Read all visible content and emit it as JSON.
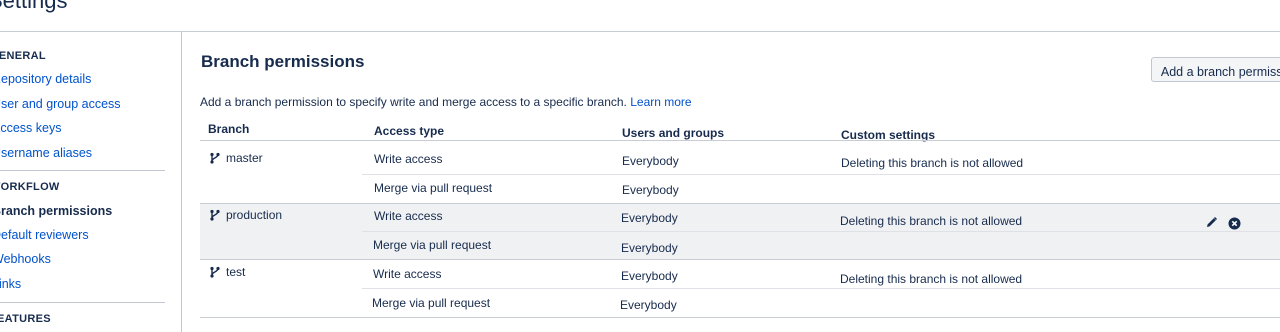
{
  "page": {
    "title": "Settings"
  },
  "sidebar": {
    "sections": [
      {
        "heading": "GENERAL",
        "items": [
          {
            "label": "Repository details"
          },
          {
            "label": "User and group access"
          },
          {
            "label": "Access keys"
          },
          {
            "label": "Username aliases"
          }
        ]
      },
      {
        "heading": "WORKFLOW",
        "items": [
          {
            "label": "Branch permissions",
            "active": true
          },
          {
            "label": "Default reviewers"
          },
          {
            "label": "Webhooks"
          },
          {
            "label": "Links"
          }
        ]
      },
      {
        "heading": "FEATURES",
        "items": []
      }
    ]
  },
  "main": {
    "title": "Branch permissions",
    "add_button": "Add a branch permission",
    "description": "Add a branch permission to specify write and merge access to a specific branch.",
    "learn_more": "Learn more",
    "columns": [
      "Branch",
      "Access type",
      "Users and groups",
      "Custom settings"
    ],
    "permissions": [
      {
        "branch": "master",
        "rows": [
          {
            "access": "Write access",
            "users": "Everybody",
            "custom": "Deleting this branch is not allowed"
          },
          {
            "access": "Merge via pull request",
            "users": "Everybody",
            "custom": ""
          }
        ]
      },
      {
        "branch": "production",
        "rows": [
          {
            "access": "Write access",
            "users": "Everybody",
            "custom": "Deleting this branch is not allowed"
          },
          {
            "access": "Merge via pull request",
            "users": "Everybody",
            "custom": ""
          }
        ]
      },
      {
        "branch": "test",
        "rows": [
          {
            "access": "Write access",
            "users": "Everybody",
            "custom": "Deleting this branch is not allowed"
          },
          {
            "access": "Merge via pull request",
            "users": "Everybody",
            "custom": ""
          }
        ]
      }
    ],
    "icons": {
      "branch": "branch-icon",
      "edit": "pencil-icon",
      "delete": "close-circle-icon"
    }
  }
}
